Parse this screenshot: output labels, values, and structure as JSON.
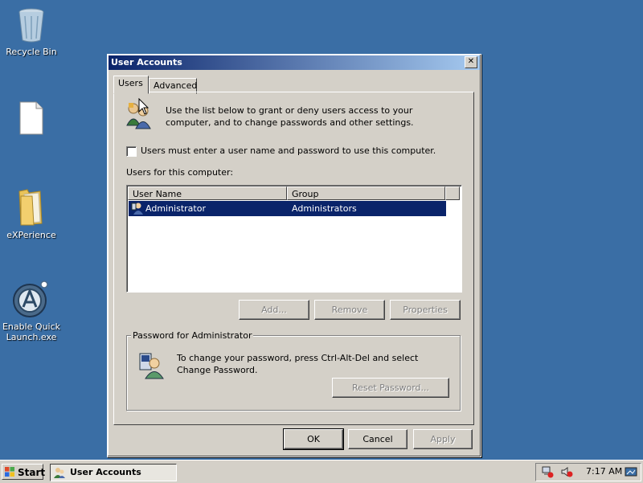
{
  "desktop": {
    "icons": [
      {
        "label": "Recycle Bin",
        "icon": "recycle-bin-icon"
      },
      {
        "label": "",
        "icon": "document-icon"
      },
      {
        "label": "eXPerience",
        "icon": "folder-icon"
      },
      {
        "label": "Enable Quick Launch.exe",
        "icon": "app-icon"
      }
    ]
  },
  "dialog": {
    "title": "User Accounts",
    "close_glyph": "✕",
    "tabs": [
      "Users",
      "Advanced"
    ],
    "intro_text": "Use the list below to grant or deny users access to your computer, and to change passwords and other settings.",
    "checkbox_label": "Users must enter a user name and password to use this computer.",
    "checkbox_checked": false,
    "users_label": "Users for this computer:",
    "columns": [
      "User Name",
      "Group"
    ],
    "rows": [
      {
        "user": "Administrator",
        "group": "Administrators",
        "selected": true
      }
    ],
    "buttons": {
      "add": "Add...",
      "remove": "Remove",
      "properties": "Properties"
    },
    "password_group": {
      "title": "Password for Administrator",
      "text": "To change your password, press Ctrl-Alt-Del and select Change Password.",
      "reset_button": "Reset Password..."
    },
    "footer": {
      "ok": "OK",
      "cancel": "Cancel",
      "apply": "Apply"
    }
  },
  "taskbar": {
    "start_label": "Start",
    "task_label": "User Accounts",
    "clock": "7:17 AM"
  },
  "colors": {
    "desktop": "#3a6ea5",
    "selection": "#0a246a",
    "title_gradient_start": "#0a246a",
    "title_gradient_end": "#a6caf0"
  }
}
